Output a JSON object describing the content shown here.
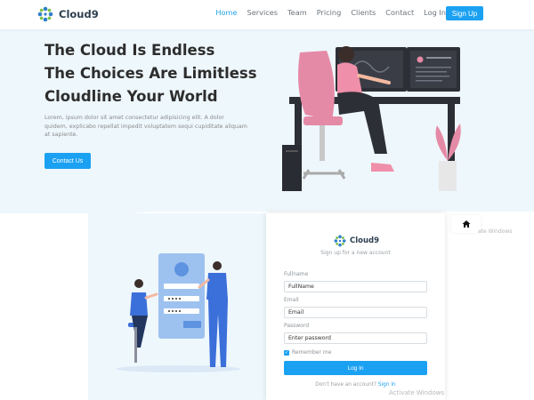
{
  "brand": {
    "name": "Cloud9"
  },
  "nav": {
    "items": [
      "Home",
      "Services",
      "Team",
      "Pricing",
      "Clients",
      "Contact",
      "Log In"
    ],
    "active": "Home",
    "signup": "Sign Up"
  },
  "hero": {
    "line1": "The Cloud Is Endless",
    "line2": "The Choices Are Limitless",
    "line3": "Cloudline Your World",
    "description": "Lorem, ipsum dolor sit amet consectetur adipisicing elit. A dolor quidem, explicabo repellat impedit voluptatem sequi cupiditate aliquam at sapiente.",
    "cta": "Contact Us"
  },
  "form": {
    "brand": "Cloud9",
    "subtitle": "Sign up for a new account",
    "fullname_label": "Fullname",
    "fullname_placeholder": "FullName",
    "email_label": "Email",
    "email_placeholder": "Email",
    "password_label": "Password",
    "password_placeholder": "Enter password",
    "remember": "Remember me",
    "submit": "Log In",
    "footer_text": "Don't have an account?",
    "footer_link": "Sign In"
  },
  "watermark": {
    "top": "ate Windows",
    "bottom": "Activate Windows"
  },
  "colors": {
    "accent": "#1ba1f2",
    "hero_bg": "#eef7fc",
    "heading": "#2d2d2d",
    "chair_pink": "#e58aa6"
  },
  "icons": [
    "cloud9-logo-icon",
    "home-icon",
    "check-icon"
  ]
}
